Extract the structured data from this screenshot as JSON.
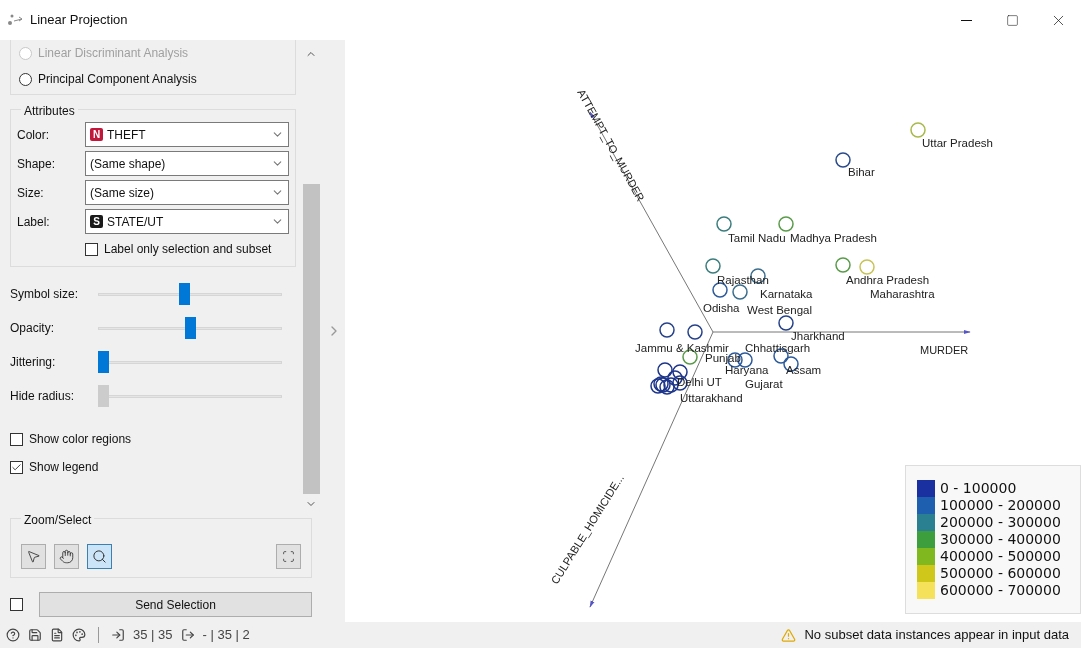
{
  "window": {
    "title": "Linear Projection"
  },
  "method_options": [
    {
      "label": "Linear Discriminant Analysis",
      "selected": false,
      "disabled": true
    },
    {
      "label": "Principal Component Analysis",
      "selected": false,
      "disabled": false
    }
  ],
  "attributes": {
    "title": "Attributes",
    "fields": [
      {
        "label": "Color:",
        "value": "THEFT",
        "badge": "N",
        "color": "#c0173b"
      },
      {
        "label": "Shape:",
        "value": "(Same shape)"
      },
      {
        "label": "Size:",
        "value": "(Same size)"
      },
      {
        "label": "Label:",
        "value": "STATE/UT",
        "badge": "S",
        "color": "#1a1a1a"
      }
    ],
    "label_only": {
      "label": "Label only selection and subset",
      "checked": false
    }
  },
  "sliders": [
    {
      "label": "Symbol size:",
      "level": 0.47,
      "disabled": false
    },
    {
      "label": "Opacity:",
      "level": 0.5,
      "disabled": false
    },
    {
      "label": "Jittering:",
      "level": 0,
      "disabled": false
    },
    {
      "label": "Hide radius:",
      "level": 0,
      "disabled": true
    }
  ],
  "checkboxes": [
    {
      "label": "Show color regions",
      "checked": false
    },
    {
      "label": "Show legend",
      "checked": true
    }
  ],
  "zoom_select": {
    "title": "Zoom/Select",
    "tools": [
      {
        "kind": "pointer",
        "selected": false
      },
      {
        "kind": "pan",
        "selected": false
      },
      {
        "kind": "zoom",
        "selected": true
      }
    ]
  },
  "send": {
    "label": "Send Selection",
    "checked": false
  },
  "plot": {
    "axes": [
      {
        "label": "MURDER"
      },
      {
        "label": "ATTEMPT_TO_MURDER"
      },
      {
        "label": "CULPABLE_HOMICIDE..."
      }
    ],
    "points": [
      {
        "label": "Uttar Pradesh",
        "color": "#a9b94a"
      },
      {
        "label": "Bihar",
        "color": "#2b4a8c"
      },
      {
        "label": "Tamil Nadu",
        "color": "#3b7d7d"
      },
      {
        "label": "Madhya Pradesh",
        "color": "#5a9b4a"
      },
      {
        "label": "Andhra Pradesh",
        "color": "#5a9b4a"
      },
      {
        "label": "Maharashtra",
        "color": "#c9c256"
      },
      {
        "label": "Rajasthan",
        "color": "#3b7d7d"
      },
      {
        "label": "Karnataka",
        "color": "#3b6d8d"
      },
      {
        "label": "Odisha",
        "color": "#2d5a9a"
      },
      {
        "label": "West Bengal",
        "color": "#3b6d8d"
      },
      {
        "label": "Jharkhand",
        "color": "#25418a"
      },
      {
        "label": "Jammu & Kashmir",
        "color": "#25418a"
      },
      {
        "label": "Punjab",
        "color": "#25418a"
      },
      {
        "label": "Chhattisgarh",
        "color": "#2d5a9a"
      },
      {
        "label": "Haryana",
        "color": "#2d5a9a"
      },
      {
        "label": "Assam",
        "color": "#2d5a9a"
      },
      {
        "label": "Delhi UT",
        "color": "#5a9b4a"
      },
      {
        "label": "Gujarat",
        "color": "#2d5a9a"
      },
      {
        "label": "Uttarakhand",
        "color": "#1d358a"
      }
    ],
    "legend": [
      {
        "label": "0 - 100000",
        "color": "#1a2fa0"
      },
      {
        "label": "100000 - 200000",
        "color": "#1f5fb0"
      },
      {
        "label": "200000 - 300000",
        "color": "#2a8090"
      },
      {
        "label": "300000 - 400000",
        "color": "#3d9e3d"
      },
      {
        "label": "400000 - 500000",
        "color": "#80b820"
      },
      {
        "label": "500000 - 600000",
        "color": "#cfc81a"
      },
      {
        "label": "600000 - 700000",
        "color": "#f5e25a"
      }
    ]
  },
  "status_bar": {
    "input": "35 | 35",
    "output": "- | 35 | 2",
    "message": "No subset data instances appear in input data"
  }
}
